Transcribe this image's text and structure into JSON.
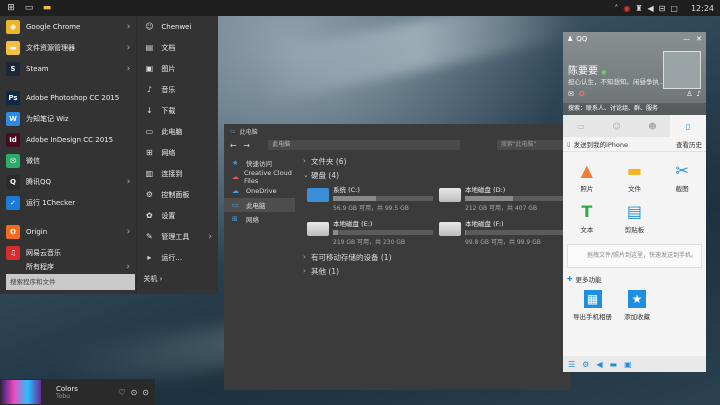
{
  "taskbar": {
    "clock": "12:24",
    "tray_icons": [
      "up-arrow-icon",
      "qq-tray-icon",
      "satellite-icon",
      "sound-icon",
      "keyboard-icon",
      "chat-icon"
    ]
  },
  "start_menu": {
    "apps": [
      {
        "label": "Google Chrome",
        "icon": "chrome-icon",
        "color": "#e8b62a",
        "glyph": "◉",
        "arrow": true
      },
      {
        "label": "文件资源管理器",
        "icon": "folder-icon",
        "color": "#f1c045",
        "glyph": "▬",
        "arrow": true
      },
      {
        "label": "Steam",
        "icon": "steam-icon",
        "color": "#1b2838",
        "glyph": "S",
        "arrow": true
      },
      {
        "label": "Adobe Photoshop CC 2015",
        "icon": "photoshop-icon",
        "color": "#0e2a47",
        "glyph": "Ps",
        "arrow": false
      },
      {
        "label": "为知笔记 Wiz",
        "icon": "wiz-icon",
        "color": "#2c8ae8",
        "glyph": "W",
        "arrow": false
      },
      {
        "label": "Adobe InDesign CC 2015",
        "icon": "indesign-icon",
        "color": "#470c20",
        "glyph": "Id",
        "arrow": false
      },
      {
        "label": "微信",
        "icon": "wechat-icon",
        "color": "#2aae67",
        "glyph": "✉",
        "arrow": false
      },
      {
        "label": "腾讯QQ",
        "icon": "qq-icon",
        "color": "#2b2b2b",
        "glyph": "Q",
        "arrow": true
      },
      {
        "label": "运行 1Checker",
        "icon": "checker-icon",
        "color": "#1d7bd8",
        "glyph": "✓",
        "arrow": false
      },
      {
        "label": "Origin",
        "icon": "origin-icon",
        "color": "#f26b1d",
        "glyph": "O",
        "arrow": true
      },
      {
        "label": "网易云音乐",
        "icon": "netease-music-icon",
        "color": "#d82b2b",
        "glyph": "♫",
        "arrow": false
      }
    ],
    "all_programs": "所有程序",
    "search_placeholder": "搜索程序和文件",
    "places": [
      {
        "label": "Chenwei",
        "icon": "user-icon",
        "glyph": "☺",
        "arrow": false
      },
      {
        "label": "文档",
        "icon": "document-icon",
        "glyph": "▤",
        "arrow": false
      },
      {
        "label": "图片",
        "icon": "picture-icon",
        "glyph": "▣",
        "arrow": false
      },
      {
        "label": "音乐",
        "icon": "music-icon",
        "glyph": "♪",
        "arrow": false
      },
      {
        "label": "下载",
        "icon": "download-icon",
        "glyph": "↓",
        "arrow": false
      },
      {
        "label": "此电脑",
        "icon": "computer-icon",
        "glyph": "▭",
        "arrow": false
      },
      {
        "label": "网络",
        "icon": "network-icon",
        "glyph": "⊞",
        "arrow": false
      },
      {
        "label": "连接到",
        "icon": "connect-icon",
        "glyph": "▥",
        "arrow": false
      },
      {
        "label": "控制面板",
        "icon": "control-panel-icon",
        "glyph": "⚙",
        "arrow": false
      },
      {
        "label": "设置",
        "icon": "settings-icon",
        "glyph": "✿",
        "arrow": false
      },
      {
        "label": "管理工具",
        "icon": "admin-tools-icon",
        "glyph": "✎",
        "arrow": true
      },
      {
        "label": "运行...",
        "icon": "run-icon",
        "glyph": "▸",
        "arrow": false
      }
    ],
    "shutdown": "关机"
  },
  "media": {
    "title": "Colors",
    "artist": "Tobu"
  },
  "explorer": {
    "title": "此电脑",
    "address": "此电脑",
    "search_placeholder": "搜索\"此电脑\"",
    "nav": [
      {
        "label": "快速访问",
        "icon": "quick-access-icon",
        "glyph": "★",
        "selected": false
      },
      {
        "label": "Creative Cloud Files",
        "icon": "creative-cloud-icon",
        "glyph": "☁",
        "selected": false
      },
      {
        "label": "OneDrive",
        "icon": "onedrive-icon",
        "glyph": "☁",
        "selected": false
      },
      {
        "label": "此电脑",
        "icon": "computer-icon",
        "glyph": "▭",
        "selected": true
      },
      {
        "label": "网络",
        "icon": "network-icon",
        "glyph": "⊞",
        "selected": false
      }
    ],
    "groups": {
      "folders": "文件夹 (6)",
      "disks": "硬盘 (4)",
      "removable": "有可移动存储的设备 (1)",
      "other": "其他 (1)"
    },
    "drives": [
      {
        "name": "系统 (C:)",
        "free": "56.9 GB 可用，共 99.5 GB",
        "used_fraction": 0.43,
        "windows": true
      },
      {
        "name": "本地磁盘 (D:)",
        "free": "212 GB 可用，共 407 GB",
        "used_fraction": 0.48,
        "windows": false
      },
      {
        "name": "本地磁盘 (E:)",
        "free": "219 GB 可用，共 230 GB",
        "used_fraction": 0.05,
        "windows": false
      },
      {
        "name": "本地磁盘 (F:)",
        "free": "99.8 GB 可用，共 99.9 GB",
        "used_fraction": 0.01,
        "windows": false
      }
    ]
  },
  "qq": {
    "title": "QQ",
    "name": "陈要要",
    "signature": "担心认生，不知想知。闲昼争执...",
    "search_placeholder": "搜索：联系人、讨论组、群、服务",
    "send_to_iphone": "发送到我的iPhone",
    "history": "查看历史",
    "items": [
      {
        "label": "照片",
        "icon": "photo-icon",
        "glyph": "▲",
        "color": "#f07a3a"
      },
      {
        "label": "文件",
        "icon": "file-folder-icon",
        "glyph": "▬",
        "color": "#f5b321"
      },
      {
        "label": "截图",
        "icon": "scissors-icon",
        "glyph": "✂",
        "color": "#1e8fe0"
      },
      {
        "label": "文本",
        "icon": "text-icon",
        "glyph": "T",
        "color": "#2fae4a"
      },
      {
        "label": "剪贴板",
        "icon": "clipboard-icon",
        "glyph": "▤",
        "color": "#1e8fe0"
      }
    ],
    "drop_hint": "拖拽文件/照片到这里，快速发送到手机。",
    "more": "更多功能",
    "features": [
      {
        "label": "导出手机相册",
        "icon": "export-album-icon",
        "glyph": "▦",
        "color": "#1e8fe0"
      },
      {
        "label": "添加收藏",
        "icon": "favorite-icon",
        "glyph": "★",
        "color": "#1e8fe0"
      }
    ]
  }
}
